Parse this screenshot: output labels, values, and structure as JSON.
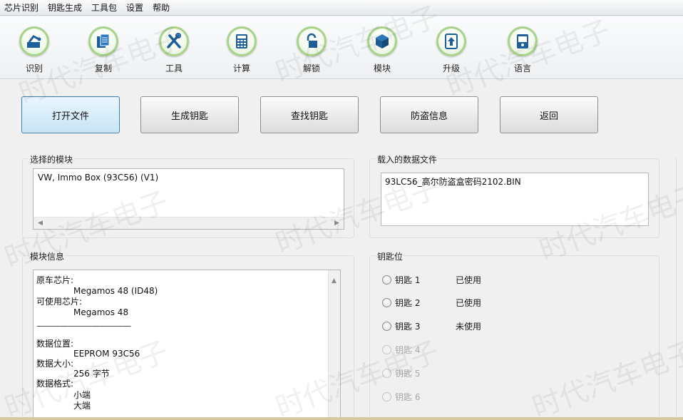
{
  "menu": [
    "芯片识别",
    "钥匙生成",
    "工具包",
    "设置",
    "帮助"
  ],
  "toolbar": [
    {
      "label": "识别",
      "icon": "identify-icon"
    },
    {
      "label": "复制",
      "icon": "copy-icon"
    },
    {
      "label": "工具",
      "icon": "tools-icon"
    },
    {
      "label": "计算",
      "icon": "calculator-icon"
    },
    {
      "label": "解锁",
      "icon": "unlock-icon"
    },
    {
      "label": "模块",
      "icon": "module-icon"
    },
    {
      "label": "升级",
      "icon": "upgrade-icon"
    },
    {
      "label": "语言",
      "icon": "language-icon"
    }
  ],
  "buttons": [
    "打开文件",
    "生成钥匙",
    "查找钥匙",
    "防盗信息",
    "返回"
  ],
  "selected_module": {
    "title": "选择的模块",
    "value": "VW, Immo Box (93C56) (V1)"
  },
  "loaded_file": {
    "title": "载入的数据文件",
    "value": "93LC56_高尔防盗盒密码2102.BIN"
  },
  "module_info": {
    "title": "模块信息",
    "lines": [
      {
        "text": "原车芯片:",
        "indent": false
      },
      {
        "text": "Megamos 48 (ID48)",
        "indent": true
      },
      {
        "text": "可使用芯片:",
        "indent": false
      },
      {
        "text": "Megamos 48",
        "indent": true
      },
      {
        "text": "数据位置:",
        "indent": false
      },
      {
        "text": "EEPROM 93C56",
        "indent": true
      },
      {
        "text": "数据大小:",
        "indent": false
      },
      {
        "text": "256 字节",
        "indent": true
      },
      {
        "text": "数据格式:",
        "indent": false
      },
      {
        "text": "小端",
        "indent": true
      },
      {
        "text": "大端",
        "indent": true
      }
    ],
    "separator": "————————————"
  },
  "key_positions": {
    "title": "钥匙位",
    "keys": [
      {
        "label": "钥匙 1",
        "status": "已使用",
        "enabled": true
      },
      {
        "label": "钥匙 2",
        "status": "已使用",
        "enabled": true
      },
      {
        "label": "钥匙 3",
        "status": "未使用",
        "enabled": true
      },
      {
        "label": "钥匙 4",
        "status": "",
        "enabled": false
      },
      {
        "label": "钥匙 5",
        "status": "",
        "enabled": false
      },
      {
        "label": "钥匙 6",
        "status": "",
        "enabled": false
      }
    ]
  },
  "watermark": "时代汽车电子",
  "colors": {
    "accent": "#3c7fb1",
    "icon_ring": "#a9d38a",
    "icon_fill": "#1d5f9a"
  }
}
